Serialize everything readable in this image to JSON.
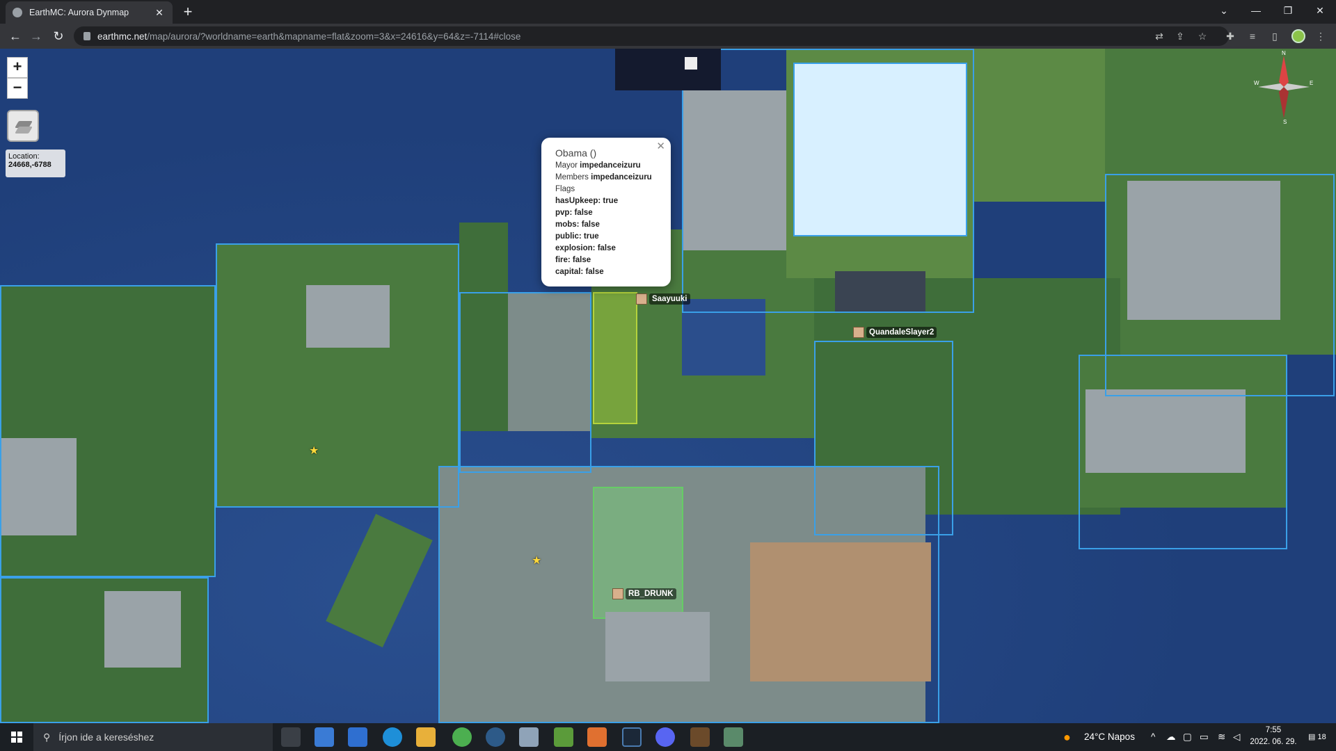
{
  "browser": {
    "tab_title": "EarthMC: Aurora Dynmap",
    "tab_close": "✕",
    "new_tab": "+",
    "url_host": "earthmc.net",
    "url_path": "/map/aurora/?worldname=earth&mapname=flat&zoom=3&x=24616&y=64&z=-7114#close"
  },
  "map": {
    "zoom_in": "+",
    "zoom_out": "−",
    "location_label": "Location:",
    "location_value": "24668,-6788",
    "compass": {
      "n": "N",
      "s": "S",
      "w": "W",
      "e": "E"
    },
    "popup": {
      "title": "Obama ()",
      "close": "✕",
      "mayor_label": "Mayor",
      "mayor": "impedanceizuru",
      "members_label": "Members",
      "members": "impedanceizuru",
      "flags_label": "Flags",
      "flags": [
        "hasUpkeep: true",
        "pvp: false",
        "mobs: false",
        "public: true",
        "explosion: false",
        "fire: false",
        "capital: false"
      ]
    },
    "players": [
      "Saayuuki",
      "QuandaleSlayer2",
      "RB_DRUNK"
    ]
  },
  "taskbar": {
    "search_placeholder": "Írjon ide a kereséshez",
    "weather": "24°C  Napos",
    "time": "7:55",
    "date": "2022. 06. 29.",
    "notifications": "18"
  }
}
